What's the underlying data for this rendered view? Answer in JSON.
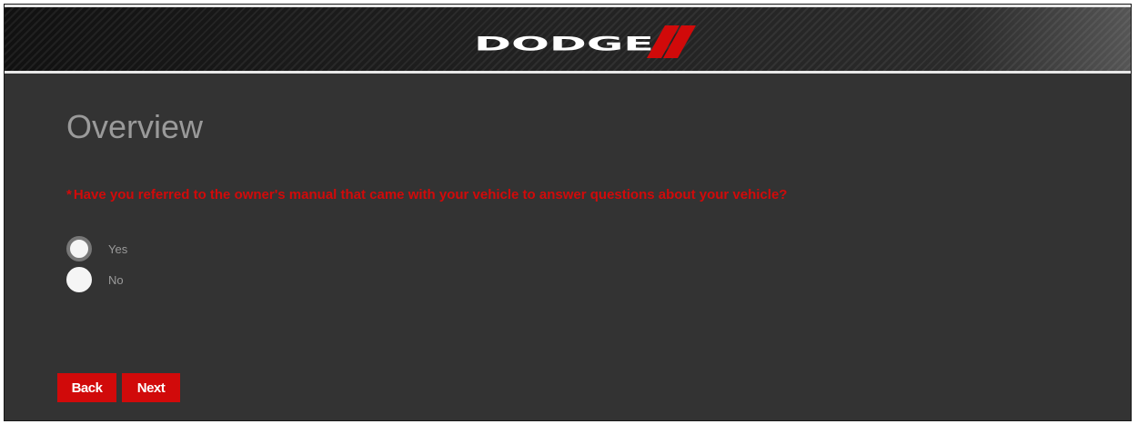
{
  "header": {
    "brand": "DODGE",
    "brand_color": "#ffffff",
    "stripe_color": "#d10a0a"
  },
  "page": {
    "title": "Overview"
  },
  "question": {
    "required_marker": "*",
    "text": "Have you referred to the owner's manual that came with your vehicle to answer questions about your vehicle?",
    "options": [
      {
        "label": "Yes",
        "selected": false
      },
      {
        "label": "No",
        "selected": false
      }
    ]
  },
  "nav": {
    "back_label": "Back",
    "next_label": "Next"
  },
  "colors": {
    "accent": "#d10a0a",
    "background": "#333333",
    "title_text": "#9a9a9a"
  }
}
